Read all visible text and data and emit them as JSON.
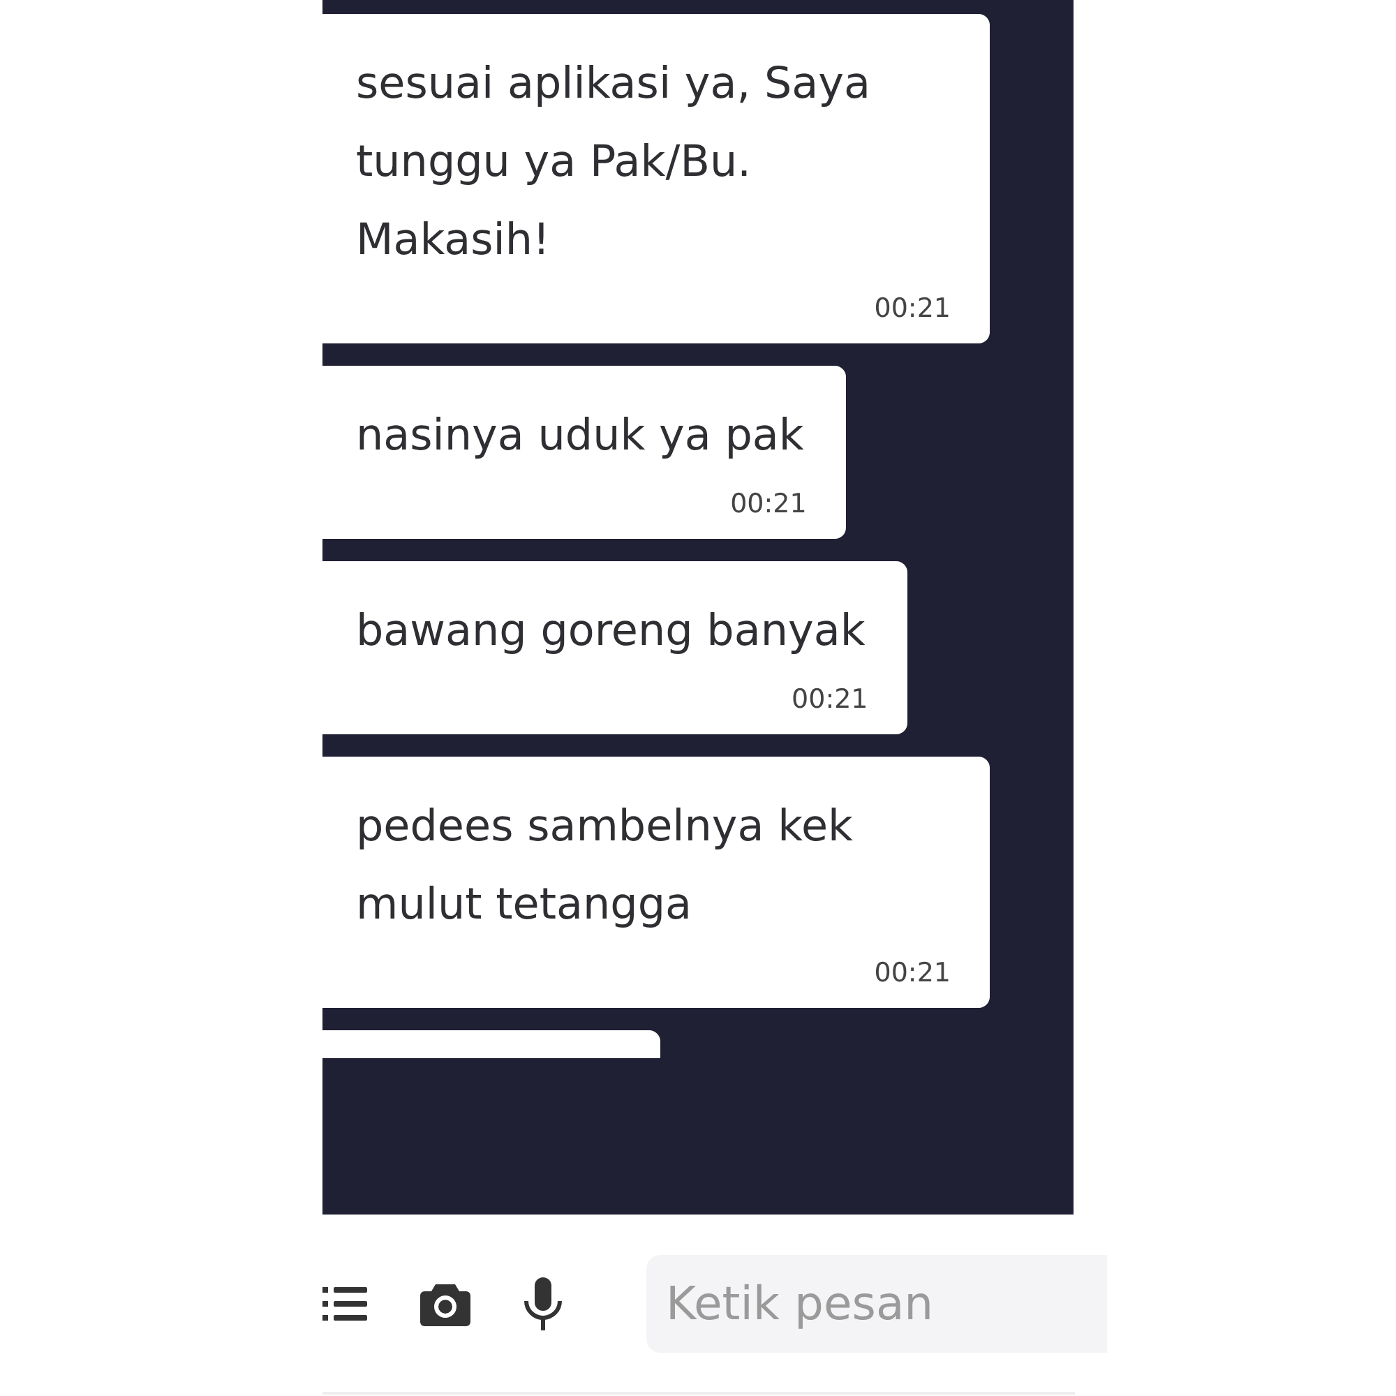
{
  "messages": [
    {
      "text": "sesuai aplikasi ya, Saya tunggu ya Pak/Bu. Makasih!",
      "time": "00:21"
    },
    {
      "text": "nasinya uduk ya pak",
      "time": "00:21"
    },
    {
      "text": "bawang goreng banyak",
      "time": "00:21"
    },
    {
      "text": "pedees sambelnya kek mulut tetangga",
      "time": "00:21"
    }
  ],
  "composer": {
    "placeholder": "Ketik pesan"
  }
}
